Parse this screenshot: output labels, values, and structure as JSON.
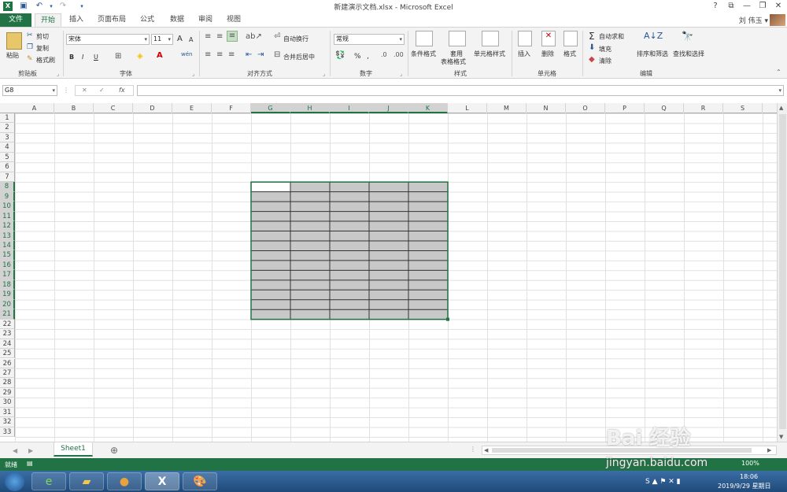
{
  "window": {
    "title": "新建演示文档.xlsx - Microsoft Excel",
    "help": "?",
    "minimize": "—",
    "restore": "❐",
    "close": "✕",
    "ribbon_display": "⧉"
  },
  "quick_access": {
    "save_icon": "💾",
    "undo": "↶",
    "redo": "↷",
    "customize": "▾"
  },
  "tabs": [
    "文件",
    "开始",
    "插入",
    "页面布局",
    "公式",
    "数据",
    "审阅",
    "视图"
  ],
  "user": {
    "name": "刘 伟玉 ▾"
  },
  "ribbon": {
    "clipboard": {
      "paste": "粘贴",
      "cut": "剪切",
      "copy": "复制",
      "format_painter": "格式刷",
      "label": "剪贴板"
    },
    "font": {
      "name": "宋体",
      "size": "11",
      "grow": "A",
      "shrink": "A",
      "bold": "B",
      "italic": "I",
      "underline": "U",
      "label": "字体",
      "phonetic": "wén"
    },
    "alignment": {
      "wrap": "自动换行",
      "merge": "合并后居中",
      "label": "对齐方式"
    },
    "number": {
      "format": "常规",
      "percent": "%",
      "comma": ",",
      "label": "数字"
    },
    "styles": {
      "conditional": "条件格式",
      "table": "套用",
      "table2": "表格格式",
      "cell_styles": "单元格样式",
      "label": "样式"
    },
    "cells": {
      "insert": "插入",
      "delete": "删除",
      "format": "格式",
      "label": "单元格"
    },
    "editing": {
      "autosum": "自动求和",
      "fill": "填充",
      "clear": "清除",
      "sort": "排序和筛选",
      "find": "查找和选择",
      "label": "编辑"
    }
  },
  "formula_bar": {
    "name_box": "G8",
    "fx": "fx",
    "cancel": "✕",
    "enter": "✓",
    "value": ""
  },
  "columns": [
    "A",
    "B",
    "C",
    "D",
    "E",
    "F",
    "G",
    "H",
    "I",
    "J",
    "K",
    "L",
    "M",
    "N",
    "O",
    "P",
    "Q",
    "R",
    "S"
  ],
  "rows": [
    "1",
    "2",
    "3",
    "4",
    "5",
    "6",
    "7",
    "8",
    "9",
    "10",
    "11",
    "12",
    "13",
    "14",
    "15",
    "16",
    "17",
    "18",
    "19",
    "20",
    "21",
    "22",
    "23",
    "24",
    "25",
    "26",
    "27",
    "28",
    "29",
    "30",
    "31",
    "32",
    "33"
  ],
  "selection": {
    "active": "G8",
    "range": "G8:K21",
    "fill_color": "#c8c8c8"
  },
  "sheets": {
    "tabs": [
      "Sheet1"
    ],
    "add": "⊕"
  },
  "status": {
    "text": "就绪",
    "zoom": "100%"
  },
  "taskbar": {
    "time": "18:06",
    "date": "2019/9/29 星期日"
  },
  "watermark": {
    "brand": "Bai  经验",
    "url": "jingyan.baidu.com"
  },
  "colors": {
    "excel_green": "#217346",
    "header_bg": "#f3f3f3",
    "grid": "#e1e1e1"
  }
}
